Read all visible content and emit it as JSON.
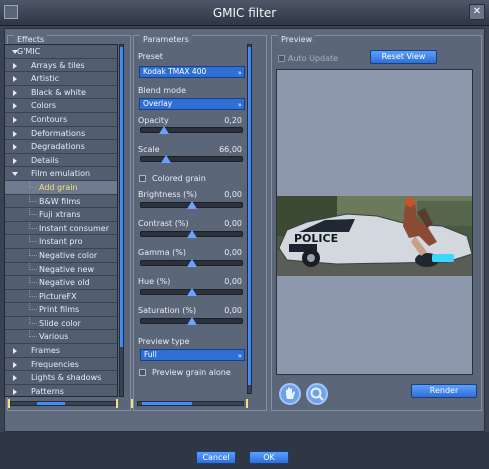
{
  "window": {
    "title": "GMIC filter"
  },
  "effects": {
    "title": "Effects",
    "root": "G'MIC",
    "items": [
      {
        "label": "Arrays & tiles",
        "kind": "folder"
      },
      {
        "label": "Artistic",
        "kind": "folder"
      },
      {
        "label": "Black & white",
        "kind": "folder"
      },
      {
        "label": "Colors",
        "kind": "folder"
      },
      {
        "label": "Contours",
        "kind": "folder"
      },
      {
        "label": "Deformations",
        "kind": "folder"
      },
      {
        "label": "Degradations",
        "kind": "folder"
      },
      {
        "label": "Details",
        "kind": "folder"
      },
      {
        "label": "Film emulation",
        "kind": "open"
      },
      {
        "label": "Add grain",
        "kind": "selected"
      },
      {
        "label": "B&W films",
        "kind": "child"
      },
      {
        "label": "Fuji xtrans",
        "kind": "child"
      },
      {
        "label": "Instant consumer",
        "kind": "child"
      },
      {
        "label": "Instant pro",
        "kind": "child"
      },
      {
        "label": "Negative color",
        "kind": "child"
      },
      {
        "label": "Negative new",
        "kind": "child"
      },
      {
        "label": "Negative old",
        "kind": "child"
      },
      {
        "label": "PictureFX",
        "kind": "child"
      },
      {
        "label": "Print films",
        "kind": "child"
      },
      {
        "label": "Slide color",
        "kind": "child"
      },
      {
        "label": "Various",
        "kind": "child"
      },
      {
        "label": "Frames",
        "kind": "folder"
      },
      {
        "label": "Frequencies",
        "kind": "folder"
      },
      {
        "label": "Lights & shadows",
        "kind": "folder"
      },
      {
        "label": "Patterns",
        "kind": "folder"
      }
    ]
  },
  "params": {
    "title": "Parameters",
    "preset_label": "Preset",
    "preset_value": "Kodak TMAX 400",
    "blend_label": "Blend mode",
    "blend_value": "Overlay",
    "opacity_label": "Opacity",
    "opacity_value": "0,20",
    "opacity_level": 0.2,
    "scale_label": "Scale",
    "scale_value": "66,00",
    "scale_level": 0.22,
    "colored_grain": "Colored grain",
    "brightness_label": "Brightness (%)",
    "brightness_value": "0,00",
    "contrast_label": "Contrast (%)",
    "contrast_value": "0,00",
    "gamma_label": "Gamma (%)",
    "gamma_value": "0,00",
    "hue_label": "Hue (%)",
    "hue_value": "0,00",
    "saturation_label": "Saturation (%)",
    "saturation_value": "0,00",
    "center_level": 0.5,
    "preview_type_label": "Preview type",
    "preview_type_value": "Full",
    "preview_grain_alone": "Preview grain alone"
  },
  "preview": {
    "title": "Preview",
    "auto_update": "Auto Update",
    "reset_view": "Reset View",
    "render": "Render",
    "car_text": "POLICE"
  },
  "footer": {
    "cancel": "Cancel",
    "ok": "OK"
  }
}
